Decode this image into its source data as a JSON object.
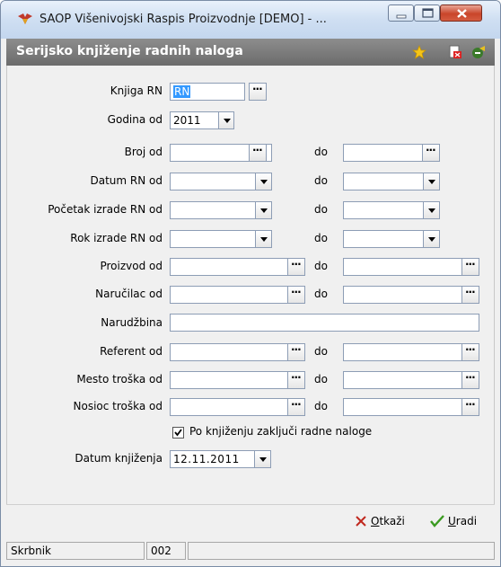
{
  "window": {
    "title": "SAOP  Višenivojski Raspis Proizvodnje [DEMO] - ...",
    "minimize_label": "minimize",
    "maximize_label": "maximize",
    "close_label": "close"
  },
  "header": {
    "title": "Serijsko knjiženje radnih naloga",
    "icons": [
      "star-icon",
      "delete-doc-icon",
      "exit-icon"
    ]
  },
  "form": {
    "knjiga_rn": {
      "label": "Knjiga RN",
      "value": "RN"
    },
    "godina_od": {
      "label": "Godina od",
      "value": "2011"
    },
    "range_label": "do",
    "rows": [
      {
        "label": "Broj od",
        "from": "",
        "to": ""
      },
      {
        "label": "Datum RN od",
        "from": "",
        "to": ""
      },
      {
        "label": "Početak izrade RN od",
        "from": "",
        "to": ""
      },
      {
        "label": "Rok izrade RN od",
        "from": "",
        "to": ""
      },
      {
        "label": "Proizvod od",
        "from": "",
        "to": ""
      },
      {
        "label": "Naručilac od",
        "from": "",
        "to": ""
      },
      {
        "label": "Referent od",
        "from": "",
        "to": ""
      },
      {
        "label": "Mesto troška od",
        "from": "",
        "to": ""
      },
      {
        "label": "Nosioc troška od",
        "from": "",
        "to": ""
      }
    ],
    "narudzbina": {
      "label": "Narudžbina",
      "value": ""
    },
    "zakljuci": {
      "label": "Po knjiženju zaključi radne naloge",
      "checked": true
    },
    "datum_knjizenja": {
      "label": "Datum knjiženja",
      "value": "12.11.2011"
    }
  },
  "footer": {
    "cancel": {
      "underline": "O",
      "rest": "tkaži"
    },
    "ok": {
      "underline": "U",
      "rest": "radi"
    }
  },
  "status": {
    "user": "Skrbnik",
    "code": "002",
    "extra": ""
  },
  "colors": {
    "header_bg": "#7a7a7a",
    "selection": "#3399ff",
    "cancel_x": "#c0281e",
    "ok_check": "#3a9a20"
  }
}
